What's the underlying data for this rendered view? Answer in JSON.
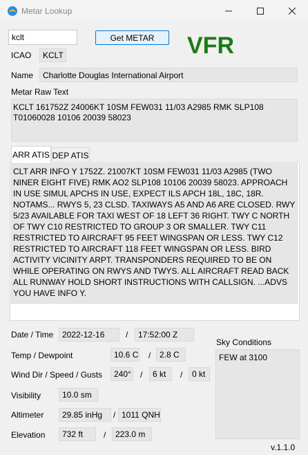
{
  "window": {
    "title": "Metar Lookup",
    "minimize_icon": "minimize-icon",
    "maximize_icon": "maximize-icon",
    "close_icon": "close-icon"
  },
  "search": {
    "value": "kclt",
    "button_label": "Get METAR"
  },
  "flight_category": {
    "text": "VFR",
    "color": "#1d7a16"
  },
  "icao": {
    "label": "ICAO",
    "value": "KCLT"
  },
  "name": {
    "label": "Name",
    "value": "Charlotte Douglas International Airport"
  },
  "metar_raw": {
    "label": "Metar Raw Text",
    "value": "KCLT 161752Z 24006KT 10SM FEW031 11/03 A2985 RMK SLP108 T01060028 10106 20039 58023"
  },
  "tabs": [
    {
      "label": "ARR ATIS",
      "active": true
    },
    {
      "label": "DEP ATIS",
      "active": false
    }
  ],
  "atis_text": "CLT ARR INFO Y 1752Z. 21007KT 10SM FEW031 11/03 A2985 (TWO NINER EIGHT FIVE) RMK AO2 SLP108 10106 20039 58023. APPROACH IN USE SIMUL APCHS IN USE, EXPECT ILS APCH 18L, 18C, 18R. NOTAMS... RWYS 5, 23 CLSD. TAXIWAYS A5 AND A6 ARE CLOSED. RWY 5/23 AVAILABLE FOR TAXI WEST OF 18 LEFT 36 RIGHT. TWY C NORTH OF TWY C10 RESTRICTED TO GROUP 3 OR SMALLER. TWY C11 RESTRICTED TO AIRCRAFT 95 FEET WINGSPAN OR LESS. TWY C12 RESTRICTED TO AIRCRAFT 118 FEET WINGSPAN OR LESS. BIRD ACTIVITY VICINITY ARPT. TRANSPONDERS REQUIRED TO BE ON WHILE OPERATING ON RWYS AND TWYS. ALL AIRCRAFT READ BACK ALL RUNWAY HOLD SHORT INSTRUCTIONS WITH CALLSIGN. ...ADVS YOU HAVE INFO Y.",
  "datetime": {
    "label": "Date / Time",
    "date": "2022-12-16",
    "sep": "/",
    "time": "17:52:00 Z"
  },
  "temp": {
    "label": "Temp / Dewpoint",
    "temp": "10.6 C",
    "sep": "/",
    "dew": "2.8 C"
  },
  "wind": {
    "label": "Wind Dir / Speed / Gusts",
    "dir": "240°",
    "sep1": "/",
    "speed": "6 kt",
    "sep2": "/",
    "gusts": "0 kt"
  },
  "visibility": {
    "label": "Visibility",
    "value": "10.0 sm"
  },
  "altimeter": {
    "label": "Altimeter",
    "inhg": "29.85 inHg",
    "sep": "/",
    "qnh": "1011 QNH"
  },
  "elevation": {
    "label": "Elevation",
    "ft": "732 ft",
    "sep": "/",
    "m": "223.0 m"
  },
  "sky": {
    "label": "Sky Conditions",
    "value": "FEW at 3100"
  },
  "version": "v.1.1.0"
}
